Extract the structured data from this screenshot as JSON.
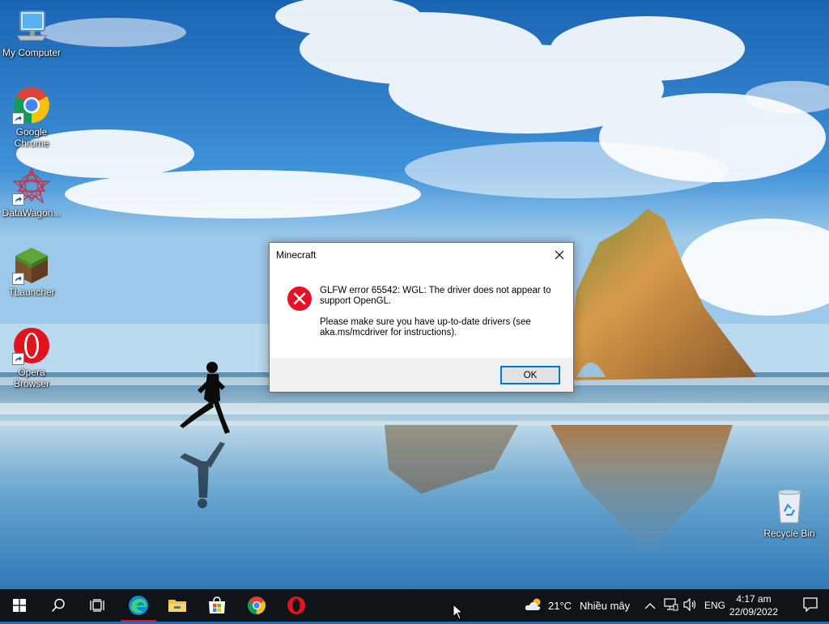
{
  "desktop": {
    "icons": [
      {
        "label": "My Computer"
      },
      {
        "label": "Google Chrome"
      },
      {
        "label": "DataWagon..."
      },
      {
        "label": "TLauncher"
      },
      {
        "label": "Opera Browser"
      },
      {
        "label": "Recycle Bin"
      }
    ]
  },
  "dialog": {
    "title": "Minecraft",
    "message_line1": "GLFW error 65542: WGL: The driver does not appear to support OpenGL.",
    "message_line2": "Please make sure you have up-to-date drivers (see aka.ms/mcdriver for instructions).",
    "ok_label": "OK",
    "icon": "error-icon"
  },
  "taskbar": {
    "pinned": [
      "start-icon",
      "search-icon",
      "task-view-icon",
      "edge-icon",
      "file-explorer-icon",
      "store-icon",
      "chrome-icon",
      "opera-icon"
    ],
    "weather": {
      "temp": "21°C",
      "condition": "Nhiều mây"
    },
    "language": "ENG",
    "time": "4:17 am",
    "date": "22/09/2022"
  },
  "colors": {
    "accent": "#0078d7",
    "error": "#e81123",
    "taskbar": "#101317"
  }
}
